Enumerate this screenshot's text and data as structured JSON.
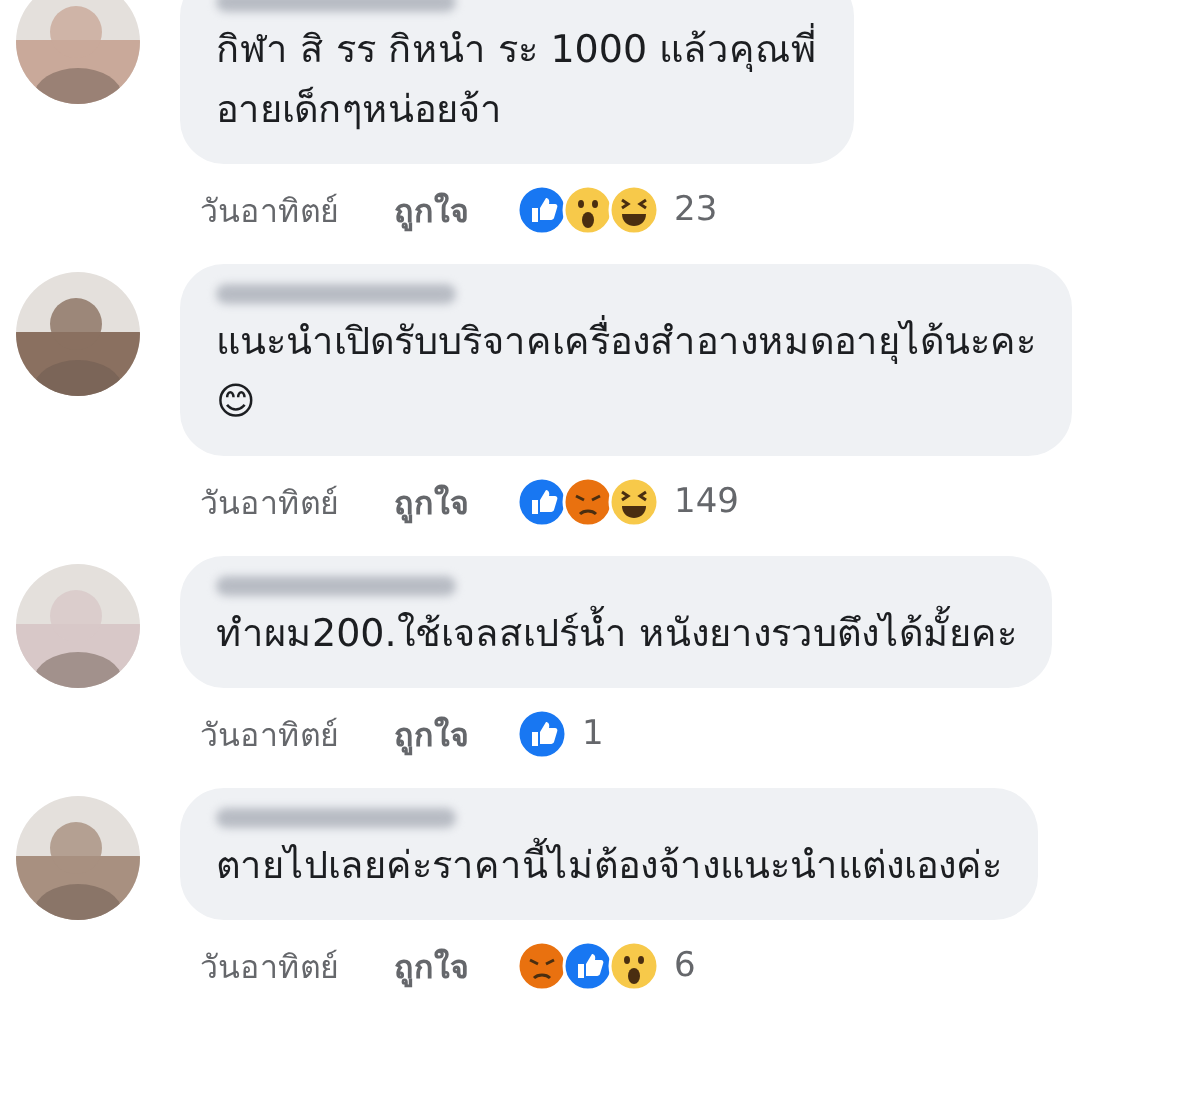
{
  "comments": [
    {
      "text": "กิฬา สิ รร กิหนำ ระ 1000 แล้วคุณพี่\nอายเด็กๆหน่อยจ้า",
      "time": "วันอาทิตย์",
      "like_label": "ถูกใจ",
      "reactions": [
        {
          "kind": "like"
        },
        {
          "kind": "wow"
        },
        {
          "kind": "haha"
        }
      ],
      "count": "23"
    },
    {
      "text": "แนะนำเปิดรับบริจาคเครื่องสำอางหมดอายุได้นะคะ\n😊",
      "time": "วันอาทิตย์",
      "like_label": "ถูกใจ",
      "reactions": [
        {
          "kind": "like"
        },
        {
          "kind": "angry"
        },
        {
          "kind": "haha"
        }
      ],
      "count": "149"
    },
    {
      "text": "ทำผม200.ใช้เจลสเปร์น้ำ หนังยางรวบตึงได้มั้ยคะ",
      "time": "วันอาทิตย์",
      "like_label": "ถูกใจ",
      "reactions": [
        {
          "kind": "like"
        }
      ],
      "count": "1"
    },
    {
      "text": "ตายไปเลยค่ะราคานี้ไม่ต้องจ้างแนะนำแต่งเองค่ะ",
      "time": "วันอาทิตย์",
      "like_label": "ถูกใจ",
      "reactions": [
        {
          "kind": "angry"
        },
        {
          "kind": "like"
        },
        {
          "kind": "wow"
        }
      ],
      "count": "6"
    }
  ]
}
